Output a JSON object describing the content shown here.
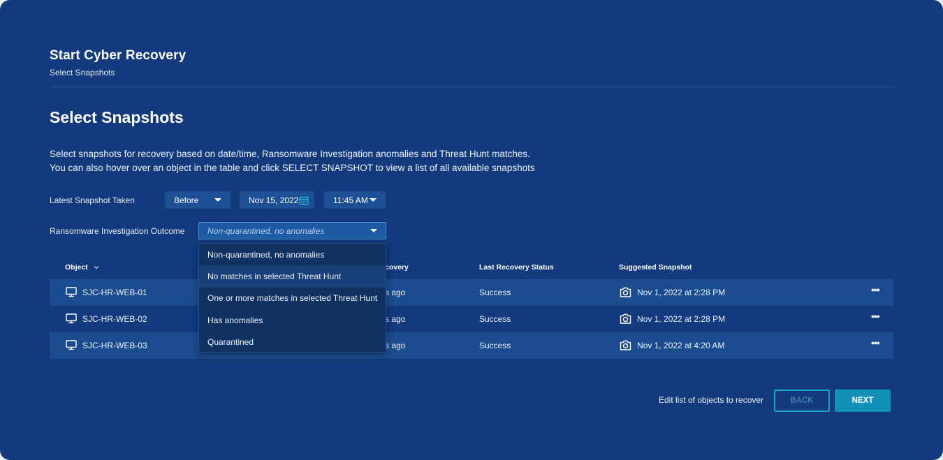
{
  "header": {
    "title": "Start Cyber Recovery",
    "subtitle": "Select Snapshots"
  },
  "section": {
    "title": "Select Snapshots",
    "description_line1": "Select snapshots for recovery based on date/time, Ransomware Investigation anomalies and Threat Hunt matches.",
    "description_line2": "You can also hover over an object in the table and click SELECT SNAPSHOT to view a list of all available snapshots"
  },
  "filters": {
    "latest_label": "Latest Snapshot Taken",
    "relation_value": "Before",
    "date_value": "Nov 15, 2022",
    "time_value": "11:45 AM",
    "outcome_label": "Ransomware Investigation Outcome",
    "outcome_placeholder": "Non-quarantined, no anomalies"
  },
  "outcome_options": [
    "Non-quarantined, no anomalies",
    "No matches in selected Threat Hunt",
    "One or more matches in selected Threat Hunt",
    "Has anomalies",
    "Quarantined"
  ],
  "table": {
    "columns": {
      "object": "Object",
      "last_recovery_partial": "covery",
      "last_recovery_status": "Last Recovery Status",
      "suggested_snapshot": "Suggested Snapshot"
    },
    "rows": [
      {
        "object": "SJC-HR-WEB-01",
        "last_recovery_partial": "s ago",
        "status": "Success",
        "snapshot": "Nov 1, 2022 at 2:28 PM"
      },
      {
        "object": "SJC-HR-WEB-02",
        "last_recovery_partial": "s ago",
        "status": "Success",
        "snapshot": "Nov 1, 2022 at 2:28 PM"
      },
      {
        "object": "SJC-HR-WEB-03",
        "last_recovery_partial": "s ago",
        "status": "Success",
        "snapshot": "Nov 1, 2022 at 4:20 AM"
      }
    ],
    "more_label": "•••"
  },
  "footer": {
    "edit_link": "Edit list of objects to recover",
    "back_label": "BACK",
    "next_label": "NEXT"
  },
  "icons": {
    "object": "desktop-icon",
    "snapshot": "camera-icon",
    "date": "calendar-icon",
    "dropdown": "caret-down-icon",
    "sort": "chevron-down-icon"
  },
  "colors": {
    "background": "#123a7c",
    "accent": "#1390b8",
    "row_shade": "#1b4c8f"
  }
}
